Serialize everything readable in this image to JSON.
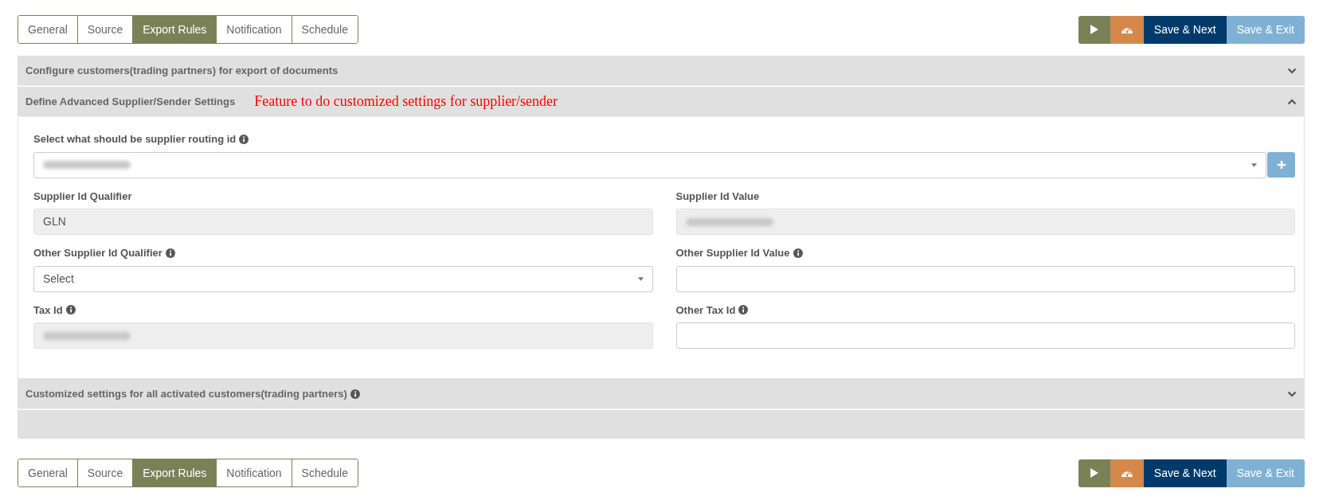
{
  "toolbars": [
    {
      "tabs": [
        {
          "label": "General",
          "selected": false
        },
        {
          "label": "Source",
          "selected": false
        },
        {
          "label": "Export Rules",
          "selected": true
        },
        {
          "label": "Notification",
          "selected": false
        },
        {
          "label": "Schedule",
          "selected": false
        }
      ],
      "buttons": [
        {
          "kind": "play"
        },
        {
          "kind": "dashboard"
        },
        {
          "kind": "primary",
          "label": "Save & Next"
        },
        {
          "kind": "secondary",
          "label": "Save & Exit"
        }
      ]
    },
    {
      "tabs": [
        {
          "label": "General",
          "selected": false
        },
        {
          "label": "Source",
          "selected": false
        },
        {
          "label": "Export Rules",
          "selected": true
        },
        {
          "label": "Notification",
          "selected": false
        },
        {
          "label": "Schedule",
          "selected": false
        }
      ],
      "buttons": [
        {
          "kind": "play"
        },
        {
          "kind": "dashboard"
        },
        {
          "kind": "primary",
          "label": "Save & Next"
        },
        {
          "kind": "secondary",
          "label": "Save & Exit"
        }
      ]
    }
  ],
  "sections": [
    {
      "title": "Configure customers(trading partners) for export of documents",
      "info": false,
      "expanded": false
    },
    {
      "title": "Define Advanced Supplier/Sender Settings",
      "info": false,
      "expanded": true,
      "note": "Feature to do customized settings for supplier/sender",
      "rows": [
        [
          {
            "label": "Select what should be supplier routing id",
            "info": true,
            "kind": "select-add",
            "blurred": true
          }
        ],
        [
          {
            "label": "Supplier Id Qualifier",
            "info": false,
            "kind": "input",
            "readonly": true,
            "value": "GLN"
          },
          {
            "label": "Supplier Id Value",
            "info": false,
            "kind": "input",
            "readonly": true,
            "blurred": true
          }
        ],
        [
          {
            "label": "Other Supplier Id Qualifier",
            "info": true,
            "kind": "select",
            "value": "Select"
          },
          {
            "label": "Other Supplier Id Value",
            "info": true,
            "kind": "input",
            "readonly": false
          }
        ],
        [
          {
            "label": "Tax Id",
            "info": true,
            "kind": "input",
            "readonly": true,
            "blurred": true
          },
          {
            "label": "Other Tax Id",
            "info": true,
            "kind": "input",
            "readonly": false
          }
        ]
      ]
    },
    {
      "title": "Customized settings for all activated customers(trading partners)",
      "info": true,
      "expanded": false,
      "filler": true
    }
  ]
}
